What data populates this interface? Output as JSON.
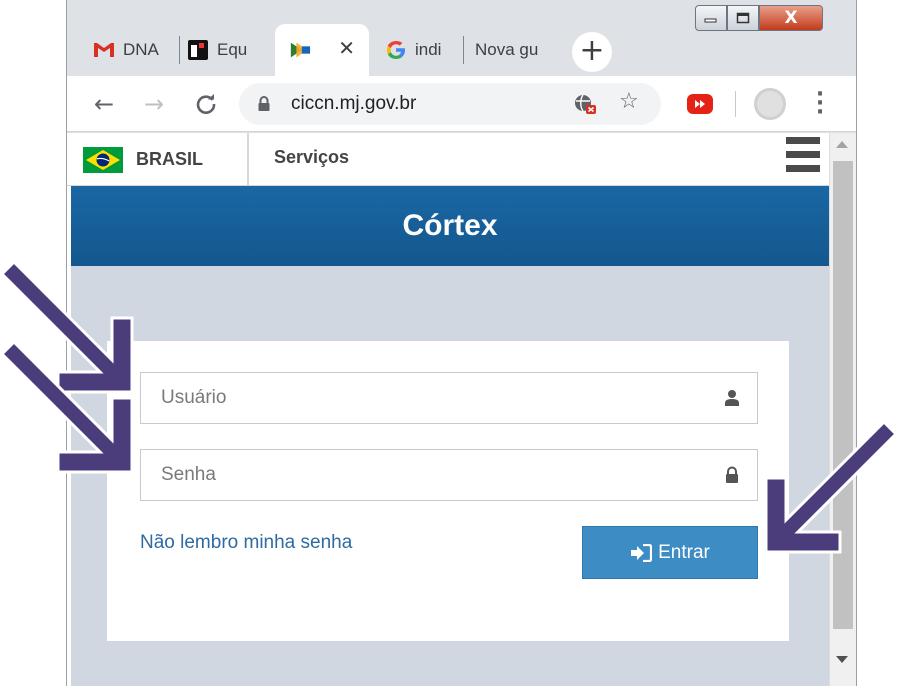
{
  "browser": {
    "tabs": [
      {
        "label": "DNA",
        "icon": "gmail-icon",
        "active": false
      },
      {
        "label": "Equ",
        "icon": "app-icon",
        "active": false
      },
      {
        "label": "",
        "icon": "cortex-favicon-icon",
        "active": true
      },
      {
        "label": "indi",
        "icon": "google-icon",
        "active": false
      },
      {
        "label": "Nova gu",
        "icon": "",
        "active": false
      }
    ],
    "new_tab_label": "+",
    "close_tab_label": "✕",
    "window_controls": {
      "minimize": "—",
      "maximize": "□",
      "close": "X"
    },
    "toolbar": {
      "back": "←",
      "forward": "→",
      "reload": "C",
      "star": "☆",
      "menu": "⋮"
    },
    "url": "ciccn.mj.gov.br"
  },
  "govbar": {
    "brand": "BRASIL",
    "services": "Serviços"
  },
  "page": {
    "title": "Córtex"
  },
  "login": {
    "username_placeholder": "Usuário",
    "password_placeholder": "Senha",
    "forgot_link": "Não lembro minha senha",
    "submit_label": "Entrar"
  },
  "colors": {
    "header_blue": "#14578e",
    "button_blue": "#3d8cc4",
    "link_blue": "#2f6aa3",
    "page_background": "#d1d7e1",
    "annotation_arrow": "#4b3d7c"
  }
}
